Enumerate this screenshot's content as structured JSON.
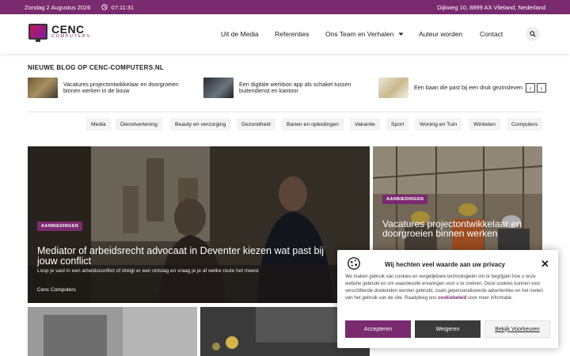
{
  "topbar": {
    "date": "Zondag 2 Augustus 2026",
    "time": "07:11:31",
    "address": "Dijkweg 10, 8899 AX Vlieland, Nederland"
  },
  "logo": {
    "name": "CENC",
    "sub": "COMPUTERS"
  },
  "nav": {
    "items": [
      "Uit de Media",
      "Referenties",
      "Ons Team en Verhalen",
      "Auteur worden",
      "Contact"
    ]
  },
  "blog": {
    "heading": "NIEUWE BLOG OP CENC-COMPUTERS.NL",
    "items": [
      "Vacatures projectontwikkelaar en doorgroeien binnen werken in de bouw",
      "Een digitale werkbon app als schakel tussen buitendienst en kantoor",
      "Een baan die past bij een druk gezinsleven"
    ],
    "prev": "‹",
    "next": "›"
  },
  "categories": [
    "Media",
    "Dienstverlening",
    "Beauty en verzorging",
    "Gezondheid",
    "Banen en opleidingen",
    "Vakantie",
    "Sport",
    "Woning en Tuin",
    "Winkelen",
    "Computers"
  ],
  "hero": {
    "badge": "AANBIEDINGEN",
    "title": "Mediator of arbeidsrecht advocaat in Deventer kiezen wat past bij jouw conflict",
    "excerpt": "Loop je vast in een arbeidsconflict of dreigt er een ontslag en vraag je je af welke route het meest",
    "author": "Cenc Computers"
  },
  "side": {
    "badge": "AANBIEDINGEN",
    "title": "Vacatures projectontwikkelaar en doorgroeien binnen werken"
  },
  "cookie": {
    "title": "Wij hechten veel waarde aan uw privacy",
    "body": "We maken gebruik van cookies en vergelijkbare technologieën om te begrijpen hoe u onze website gebruikt en om waardevolle ervaringen voor u te creëren. Deze cookies kunnen voor verschillende doeleinden worden gebruikt, zoals gepersonaliseerde advertenties en het meten van het gebruik van de site. Raadpleeg ons",
    "link": "cookiebeleid",
    "tail": "voor meer informatie.",
    "accept": "Accepteren",
    "refuse": "Weigeren",
    "prefs": "Bekijk Voorkeuren",
    "close": "✕"
  },
  "colors": {
    "brand": "#7a2a6e",
    "dark": "#3a3a3a"
  },
  "icons": [
    "calendar-icon",
    "clock-icon",
    "location-icon",
    "search-icon",
    "chevron-down-icon",
    "cookie-icon",
    "close-icon"
  ]
}
